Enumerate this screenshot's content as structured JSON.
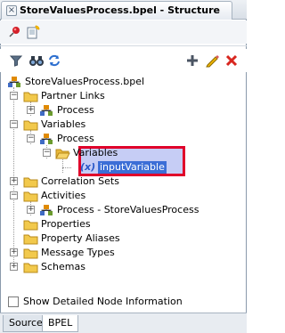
{
  "window": {
    "title": "StoreValuesProcess.bpel - Structure"
  },
  "icons": {
    "pin": "pin-icon",
    "new": "new-document-icon",
    "filter": "filter-icon",
    "find": "binoculars-icon",
    "sync": "sync-icon",
    "add": "add-icon",
    "edit": "pencil-icon",
    "delete": "delete-icon"
  },
  "tree": {
    "root": "StoreValuesProcess.bpel",
    "partner_links": "Partner Links",
    "partner_process": "Process",
    "variables": "Variables",
    "var_process": "Process",
    "var_variables": "Variables",
    "input_variable": "inputVariable",
    "correlation_sets": "Correlation Sets",
    "activities": "Activities",
    "activity_process": "Process - StoreValuesProcess",
    "properties": "Properties",
    "property_aliases": "Property Aliases",
    "message_types": "Message Types",
    "schemas": "Schemas"
  },
  "footer": {
    "show_detailed": "Show Detailed Node Information",
    "show_detailed_checked": false
  },
  "tabs": {
    "source": "Source",
    "bpel": "BPEL",
    "active": "BPEL"
  },
  "colors": {
    "highlight_fill": "#c6cdf5",
    "highlight_border": "#e0002a",
    "selection": "#3c6ed6",
    "folder": "#f2c94c"
  }
}
